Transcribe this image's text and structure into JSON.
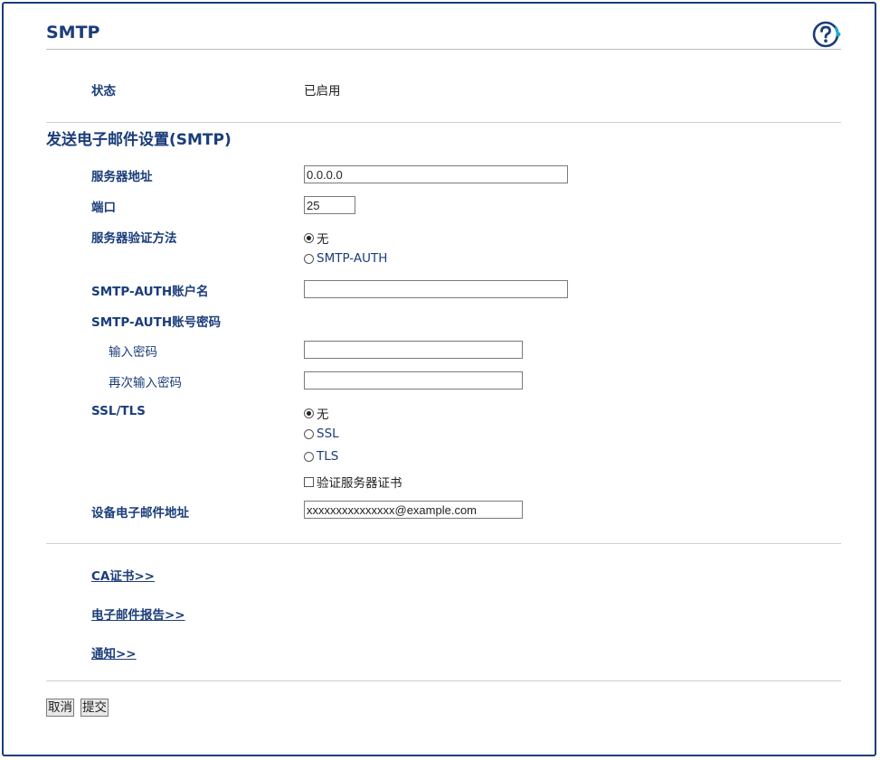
{
  "header": {
    "title": "SMTP",
    "help_icon": "help-question-icon"
  },
  "status": {
    "label": "状态",
    "value": "已启用"
  },
  "section": {
    "title": "发送电子邮件设置(SMTP)"
  },
  "form": {
    "server_address": {
      "label": "服务器地址",
      "value": "0.0.0.0"
    },
    "port": {
      "label": "端口",
      "value": "25"
    },
    "auth_method": {
      "label": "服务器验证方法",
      "options": [
        {
          "label": "无",
          "selected": true
        },
        {
          "label": "SMTP-AUTH",
          "selected": false
        }
      ]
    },
    "auth_account": {
      "label": "SMTP-AUTH账户名",
      "value": ""
    },
    "auth_password": {
      "label": "SMTP-AUTH账号密码",
      "enter_label": "输入密码",
      "reenter_label": "再次输入密码"
    },
    "ssl_tls": {
      "label": "SSL/TLS",
      "options": [
        {
          "label": "无",
          "selected": true
        },
        {
          "label": "SSL",
          "selected": false
        },
        {
          "label": "TLS",
          "selected": false
        }
      ],
      "verify_label": "验证服务器证书",
      "verify_checked": false
    },
    "device_email": {
      "label": "设备电子邮件地址",
      "value": "xxxxxxxxxxxxxxx@example.com"
    }
  },
  "links": {
    "ca_cert": "CA证书>>",
    "email_report": "电子邮件报告>>",
    "notification": "通知>>"
  },
  "buttons": {
    "cancel": "取消",
    "submit": "提交"
  },
  "colors": {
    "accent": "#1b3d7a",
    "frame_border": "#1b3d7a",
    "help_ring": "#1ea7d8"
  }
}
